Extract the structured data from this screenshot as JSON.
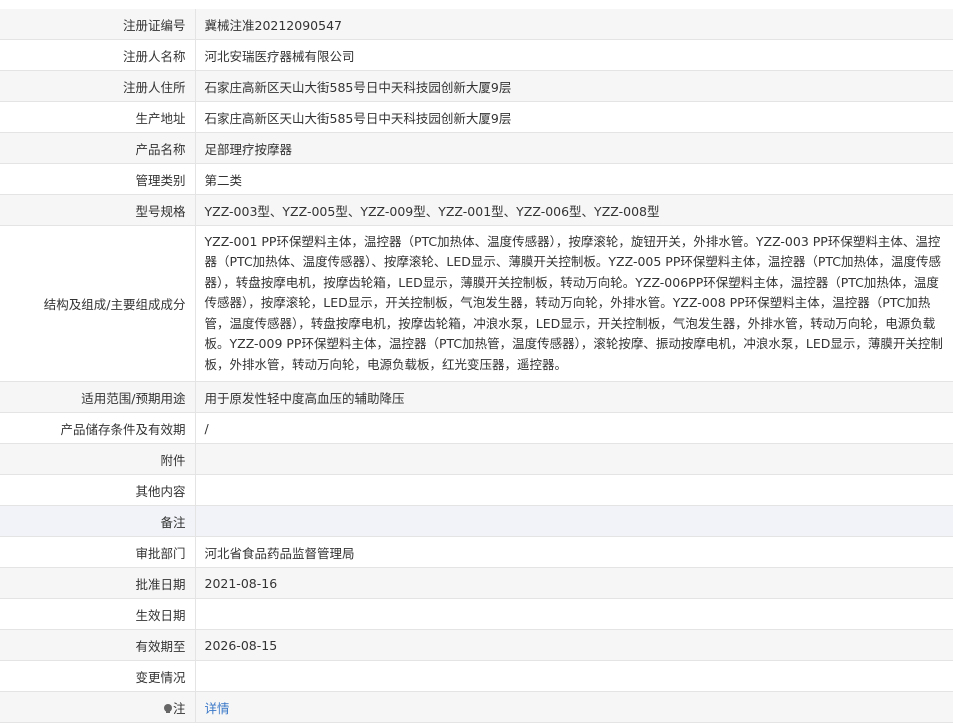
{
  "rows": [
    {
      "label": "注册证编号",
      "value": "冀械注准20212090547"
    },
    {
      "label": "注册人名称",
      "value": "河北安瑞医疗器械有限公司"
    },
    {
      "label": "注册人住所",
      "value": "石家庄高新区天山大街585号日中天科技园创新大厦9层"
    },
    {
      "label": "生产地址",
      "value": "石家庄高新区天山大街585号日中天科技园创新大厦9层"
    },
    {
      "label": "产品名称",
      "value": "足部理疗按摩器"
    },
    {
      "label": "管理类别",
      "value": "第二类"
    },
    {
      "label": "型号规格",
      "value": "YZZ-003型、YZZ-005型、YZZ-009型、YZZ-001型、YZZ-006型、YZZ-008型"
    },
    {
      "label": "结构及组成/主要组成成分",
      "value": "YZZ-001 PP环保塑料主体，温控器（PTC加热体、温度传感器），按摩滚轮，旋钮开关，外排水管。YZZ-003 PP环保塑料主体、温控器（PTC加热体、温度传感器）、按摩滚轮、LED显示、薄膜开关控制板。YZZ-005 PP环保塑料主体，温控器（PTC加热体，温度传感器），转盘按摩电机，按摩齿轮箱，LED显示，薄膜开关控制板，转动万向轮。YZZ-006PP环保塑料主体，温控器（PTC加热体，温度传感器），按摩滚轮，LED显示，开关控制板，气泡发生器，转动万向轮，外排水管。YZZ-008 PP环保塑料主体，温控器（PTC加热管，温度传感器），转盘按摩电机，按摩齿轮箱，冲浪水泵，LED显示，开关控制板，气泡发生器，外排水管，转动万向轮，电源负载板。YZZ-009 PP环保塑料主体，温控器（PTC加热管，温度传感器），滚轮按摩、振动按摩电机，冲浪水泵，LED显示，薄膜开关控制板，外排水管，转动万向轮，电源负载板，红光变压器，遥控器。"
    },
    {
      "label": "适用范围/预期用途",
      "value": "用于原发性轻中度高血压的辅助降压"
    },
    {
      "label": "产品储存条件及有效期",
      "value": "/"
    },
    {
      "label": "附件",
      "value": ""
    },
    {
      "label": "其他内容",
      "value": ""
    },
    {
      "label": "备注",
      "value": ""
    },
    {
      "label": "审批部门",
      "value": "河北省食品药品监督管理局"
    },
    {
      "label": "批准日期",
      "value": "2021-08-16"
    },
    {
      "label": "生效日期",
      "value": ""
    },
    {
      "label": "有效期至",
      "value": "2026-08-15"
    },
    {
      "label": "变更情况",
      "value": ""
    }
  ],
  "note": {
    "label": "注",
    "icon": "lightbulb-icon",
    "link_text": "详情",
    "link_color": "#3a78c8"
  }
}
